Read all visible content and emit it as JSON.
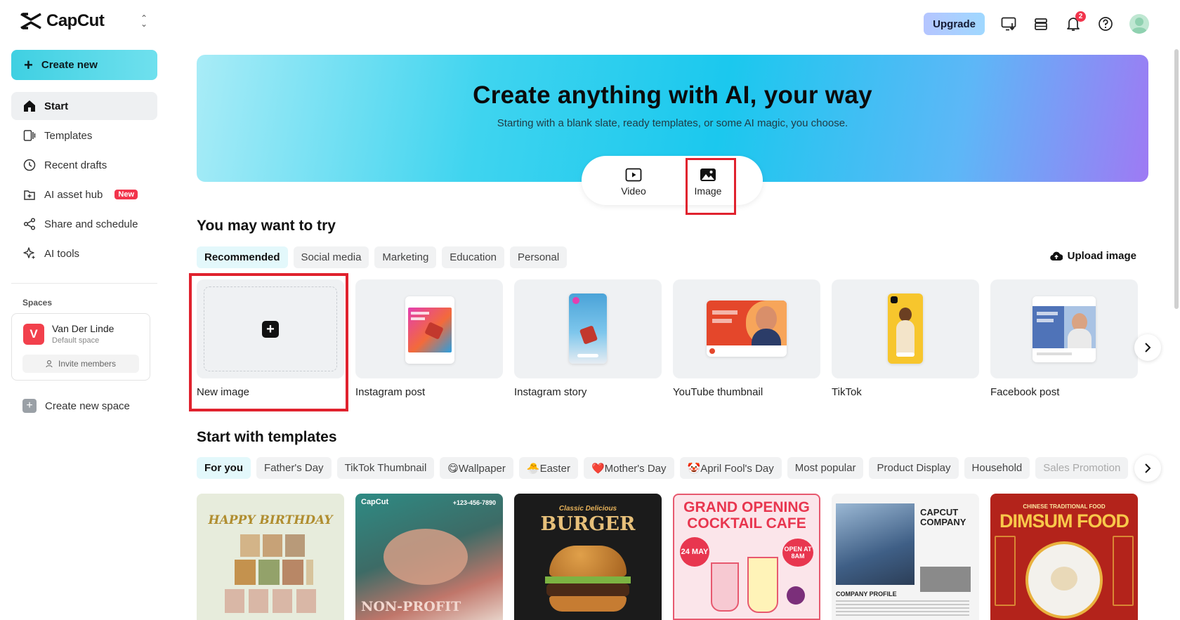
{
  "brand": {
    "name": "CapCut"
  },
  "sidebar": {
    "create_label": "Create new",
    "items": [
      {
        "label": "Start",
        "icon": "home-icon",
        "active": true
      },
      {
        "label": "Templates",
        "icon": "templates-icon"
      },
      {
        "label": "Recent drafts",
        "icon": "clock-icon"
      },
      {
        "label": "AI asset hub",
        "icon": "asset-hub-icon",
        "badge": "New"
      },
      {
        "label": "Share and schedule",
        "icon": "share-icon"
      },
      {
        "label": "AI tools",
        "icon": "sparkle-icon"
      }
    ],
    "spaces_label": "Spaces",
    "space": {
      "initial": "V",
      "name": "Van Der Linde",
      "sub": "Default space",
      "invite_label": "Invite members"
    },
    "new_space_label": "Create new space"
  },
  "header": {
    "upgrade_label": "Upgrade",
    "notification_count": "2"
  },
  "hero": {
    "title": "Create anything with AI, your way",
    "subtitle": "Starting with a blank slate, ready templates, or some AI magic, you choose.",
    "modes": [
      {
        "label": "Video"
      },
      {
        "label": "Image",
        "active": true
      }
    ]
  },
  "try_section": {
    "title": "You may want to try",
    "tabs": [
      "Recommended",
      "Social media",
      "Marketing",
      "Education",
      "Personal"
    ],
    "upload_label": "Upload image",
    "cards": [
      "New image",
      "Instagram post",
      "Instagram story",
      "YouTube thumbnail",
      "TikTok",
      "Facebook post"
    ]
  },
  "templates_section": {
    "title": "Start with templates",
    "tabs": [
      "For you",
      "Father's Day",
      "TikTok Thumbnail",
      "😋Wallpaper",
      "🐣Easter",
      "❤️Mother's Day",
      "🤡April Fool's Day",
      "Most popular",
      "Product Display",
      "Household",
      "Sales Promotion"
    ],
    "cards": [
      {
        "title": "HAPPY BIRTHDAY"
      },
      {
        "brand": "CapCut",
        "phone": "+123-456-7890",
        "title": "NON-PROFIT"
      },
      {
        "kicker": "Classic Delicious",
        "title": "BURGER"
      },
      {
        "title": "GRAND OPENING COCKTAIL CAFE",
        "date": "24 MAY",
        "badge": "OPEN AT 8AM"
      },
      {
        "title": "CAPCUT COMPANY",
        "caption": "COMPANY PROFILE"
      },
      {
        "kicker": "CHINESE TRADITIONAL FOOD",
        "title": "DIMSUM FOOD"
      }
    ]
  }
}
